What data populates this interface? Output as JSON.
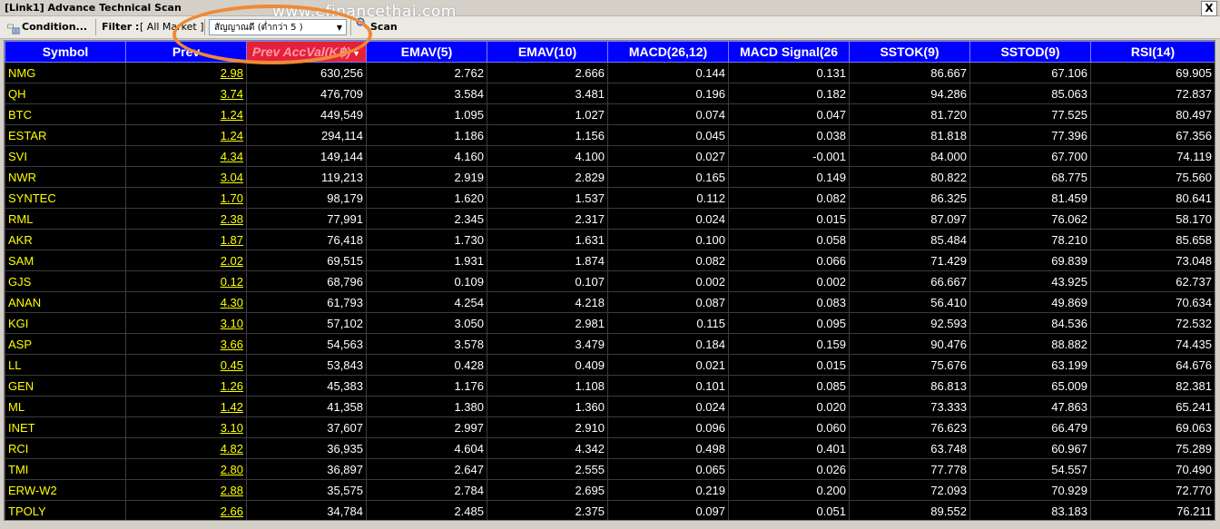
{
  "window": {
    "title": "[Link1] Advance Technical Scan",
    "close_label": "X"
  },
  "toolbar": {
    "condition_label": "Condition...",
    "filter_label": "Filter :",
    "filter_value": "[ All Market ]",
    "signal_dropdown_value": "สัญญาณดี (ต่ำกว่า 5 )",
    "scan_label": "Scan"
  },
  "watermark": "www.efinancethai.com",
  "grid": {
    "columns": [
      "Symbol",
      "Prev",
      "Prev AccVal(K฿)",
      "EMAV(5)",
      "EMAV(10)",
      "MACD(26,12)",
      "MACD Signal(26",
      "SSTOK(9)",
      "SSTOD(9)",
      "RSI(14)"
    ],
    "sorted_column": "Prev AccVal(K฿)",
    "rows": [
      [
        "NMG",
        "2.98",
        "630,256",
        "2.762",
        "2.666",
        "0.144",
        "0.131",
        "86.667",
        "67.106",
        "69.905"
      ],
      [
        "QH",
        "3.74",
        "476,709",
        "3.584",
        "3.481",
        "0.196",
        "0.182",
        "94.286",
        "85.063",
        "72.837"
      ],
      [
        "BTC",
        "1.24",
        "449,549",
        "1.095",
        "1.027",
        "0.074",
        "0.047",
        "81.720",
        "77.525",
        "80.497"
      ],
      [
        "ESTAR",
        "1.24",
        "294,114",
        "1.186",
        "1.156",
        "0.045",
        "0.038",
        "81.818",
        "77.396",
        "67.356"
      ],
      [
        "SVI",
        "4.34",
        "149,144",
        "4.160",
        "4.100",
        "0.027",
        "-0.001",
        "84.000",
        "67.700",
        "74.119"
      ],
      [
        "NWR",
        "3.04",
        "119,213",
        "2.919",
        "2.829",
        "0.165",
        "0.149",
        "80.822",
        "68.775",
        "75.560"
      ],
      [
        "SYNTEC",
        "1.70",
        "98,179",
        "1.620",
        "1.537",
        "0.112",
        "0.082",
        "86.325",
        "81.459",
        "80.641"
      ],
      [
        "RML",
        "2.38",
        "77,991",
        "2.345",
        "2.317",
        "0.024",
        "0.015",
        "87.097",
        "76.062",
        "58.170"
      ],
      [
        "AKR",
        "1.87",
        "76,418",
        "1.730",
        "1.631",
        "0.100",
        "0.058",
        "85.484",
        "78.210",
        "85.658"
      ],
      [
        "SAM",
        "2.02",
        "69,515",
        "1.931",
        "1.874",
        "0.082",
        "0.066",
        "71.429",
        "69.839",
        "73.048"
      ],
      [
        "GJS",
        "0.12",
        "68,796",
        "0.109",
        "0.107",
        "0.002",
        "0.002",
        "66.667",
        "43.925",
        "62.737"
      ],
      [
        "ANAN",
        "4.30",
        "61,793",
        "4.254",
        "4.218",
        "0.087",
        "0.083",
        "56.410",
        "49.869",
        "70.634"
      ],
      [
        "KGI",
        "3.10",
        "57,102",
        "3.050",
        "2.981",
        "0.115",
        "0.095",
        "92.593",
        "84.536",
        "72.532"
      ],
      [
        "ASP",
        "3.66",
        "54,563",
        "3.578",
        "3.479",
        "0.184",
        "0.159",
        "90.476",
        "88.882",
        "74.435"
      ],
      [
        "LL",
        "0.45",
        "53,843",
        "0.428",
        "0.409",
        "0.021",
        "0.015",
        "75.676",
        "63.199",
        "64.676"
      ],
      [
        "GEN",
        "1.26",
        "45,383",
        "1.176",
        "1.108",
        "0.101",
        "0.085",
        "86.813",
        "65.009",
        "82.381"
      ],
      [
        "ML",
        "1.42",
        "41,358",
        "1.380",
        "1.360",
        "0.024",
        "0.020",
        "73.333",
        "47.863",
        "65.241"
      ],
      [
        "INET",
        "3.10",
        "37,607",
        "2.997",
        "2.910",
        "0.096",
        "0.060",
        "76.623",
        "66.479",
        "69.063"
      ],
      [
        "RCI",
        "4.82",
        "36,935",
        "4.604",
        "4.342",
        "0.498",
        "0.401",
        "63.748",
        "60.967",
        "75.289"
      ],
      [
        "TMI",
        "2.80",
        "36,897",
        "2.647",
        "2.555",
        "0.065",
        "0.026",
        "77.778",
        "54.557",
        "70.490"
      ],
      [
        "ERW-W2",
        "2.88",
        "35,575",
        "2.784",
        "2.695",
        "0.219",
        "0.200",
        "72.093",
        "70.929",
        "72.770"
      ],
      [
        "TPOLY",
        "2.66",
        "34,784",
        "2.485",
        "2.375",
        "0.097",
        "0.051",
        "89.552",
        "83.183",
        "76.211"
      ]
    ]
  }
}
